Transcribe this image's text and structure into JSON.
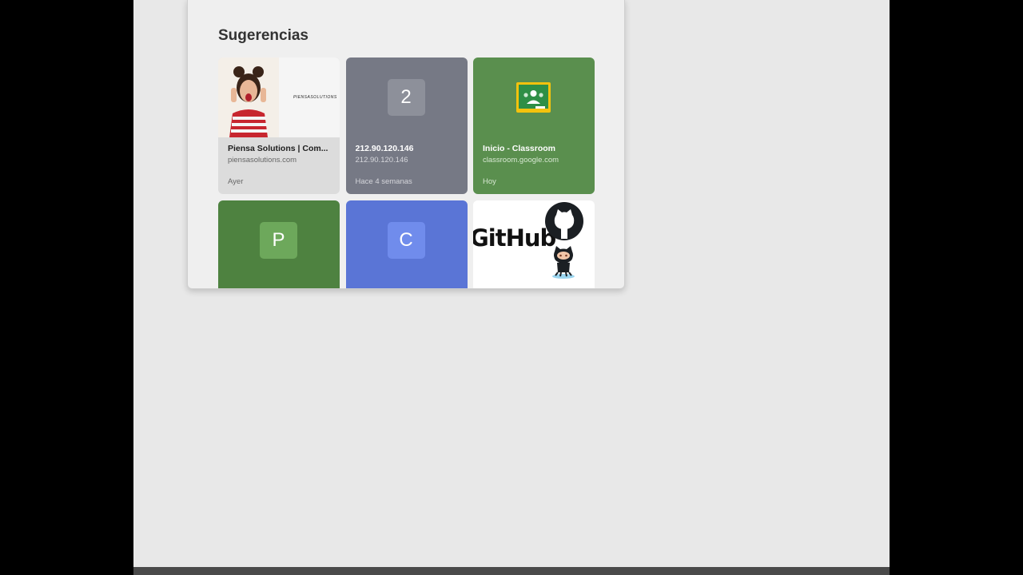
{
  "suggestions": {
    "title": "Sugerencias",
    "tiles": [
      {
        "kind": "thumbnail",
        "title": "Piensa Solutions | Com...",
        "url": "piensasolutions.com",
        "time": "Ayer",
        "brand_text": "PIENSASOLUTIONS"
      },
      {
        "kind": "letter",
        "letter": "2",
        "title": "212.90.120.146",
        "url": "212.90.120.146",
        "time": "Hace 4 semanas",
        "color": "#767985"
      },
      {
        "kind": "icon",
        "icon": "google-classroom-icon",
        "title": "Inicio - Classroom",
        "url": "classroom.google.com",
        "time": "Hoy",
        "color": "#5a8f4e"
      },
      {
        "kind": "letter",
        "letter": "P",
        "color": "#4e8240"
      },
      {
        "kind": "letter",
        "letter": "C",
        "color": "#5a75d6"
      },
      {
        "kind": "thumbnail",
        "brand_text": "GitHub",
        "icon": "github-icon"
      }
    ]
  }
}
